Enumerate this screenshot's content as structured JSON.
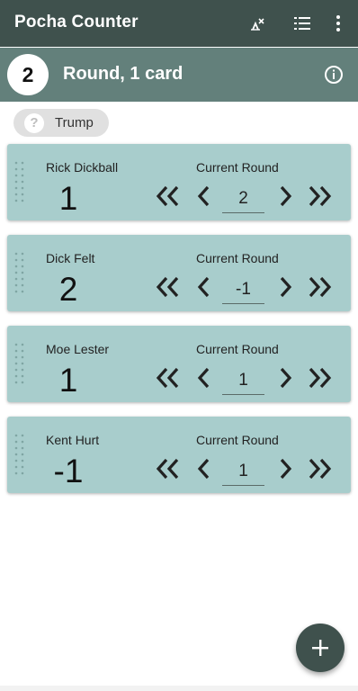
{
  "app": {
    "title": "Pocha Counter"
  },
  "toolbar": {
    "icons": [
      "clear-scores-icon",
      "list-icon",
      "more-vert-icon"
    ]
  },
  "round": {
    "number": "2",
    "title": "Round, 1 card",
    "info_icon": "info-icon"
  },
  "trump": {
    "label": "Trump",
    "icon": "question-mark-icon"
  },
  "players": [
    {
      "name": "Rick Dickball",
      "score": "1",
      "current_round_label": "Current Round",
      "bid": "2"
    },
    {
      "name": "Dick Felt",
      "score": "2",
      "current_round_label": "Current Round",
      "bid": "-1"
    },
    {
      "name": "Moe Lester",
      "score": "1",
      "current_round_label": "Current Round",
      "bid": "1"
    },
    {
      "name": "Kent Hurt",
      "score": "-1",
      "current_round_label": "Current Round",
      "bid": "1"
    }
  ],
  "fab": {
    "icon": "add-icon"
  },
  "colors": {
    "appbar": "#3f514d",
    "roundbar": "#63807b",
    "card": "#a8cdcc",
    "fab": "#3f514d"
  }
}
